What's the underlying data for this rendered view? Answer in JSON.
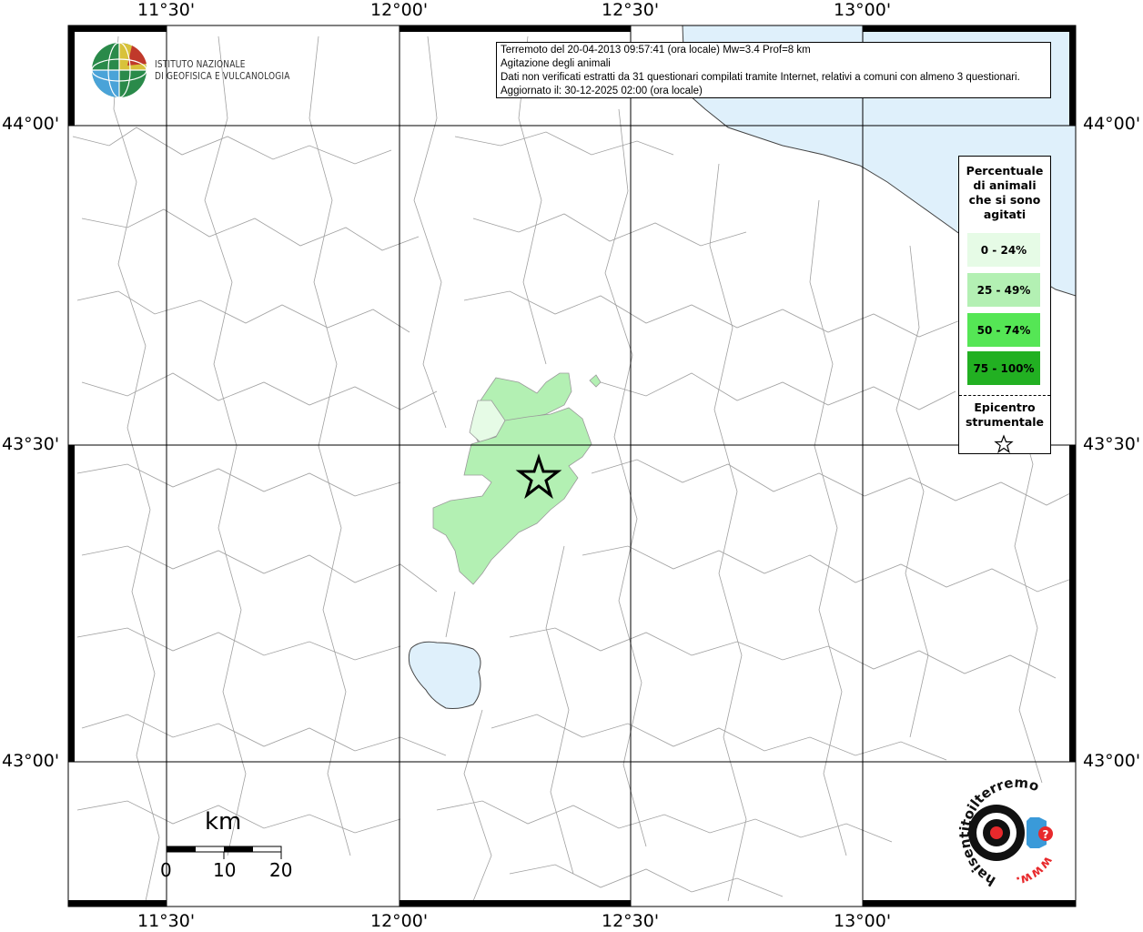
{
  "info": {
    "line1": "Terremoto del 20-04-2013 09:57:41 (ora locale) Mw=3.4 Prof=8 km",
    "line2": "Agitazione degli animali",
    "line3": "Dati non verificati estratti da 31 questionari compilati tramite Internet, relativi a comuni con almeno 3 questionari.",
    "line4": "Aggiornato il: 30-12-2025 02:00 (ora locale)"
  },
  "logo": {
    "line1": "ISTITUTO NAZIONALE",
    "line2": "DI GEOFISICA E VULCANOLOGIA"
  },
  "legend": {
    "title_lines": [
      "Percentuale",
      "di animali",
      "che si sono",
      "agitati"
    ],
    "classes": [
      {
        "label": "0 - 24%",
        "color": "#e6fbe6"
      },
      {
        "label": "25 - 49%",
        "color": "#b3f0b3"
      },
      {
        "label": "50 - 74%",
        "color": "#55e655"
      },
      {
        "label": "75 - 100%",
        "color": "#22b022"
      }
    ],
    "epicenter_line1": "Epicentro",
    "epicenter_line2": "strumentale"
  },
  "axes": {
    "lon_labels": [
      "11°30'",
      "12°00'",
      "12°30'",
      "13°00'"
    ],
    "lat_labels": [
      "44°00'",
      "43°30'",
      "43°00'"
    ]
  },
  "scale_bar": {
    "unit": "km",
    "ticks": [
      "0",
      "10",
      "20"
    ]
  },
  "watermark": {
    "text": "haisentitoilterremoto.it",
    "url_text": "www."
  },
  "colors": {
    "sea": "#dff0fb",
    "lake": "#dff0fb",
    "border": "#9a9a9a"
  }
}
